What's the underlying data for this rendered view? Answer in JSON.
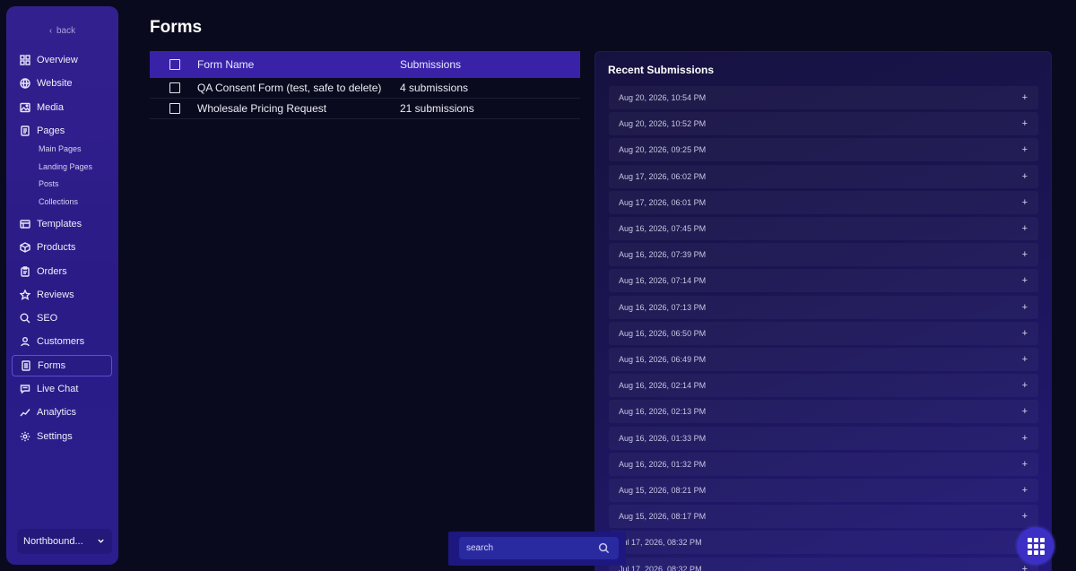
{
  "sidebar": {
    "back_label": "back",
    "items": [
      {
        "label": "Overview",
        "icon": "grid-icon"
      },
      {
        "label": "Website",
        "icon": "globe-icon"
      },
      {
        "label": "Media",
        "icon": "image-icon"
      },
      {
        "label": "Pages",
        "icon": "page-icon"
      },
      {
        "label": "Templates",
        "icon": "templates-icon"
      },
      {
        "label": "Products",
        "icon": "box-icon"
      },
      {
        "label": "Orders",
        "icon": "clipboard-icon"
      },
      {
        "label": "Reviews",
        "icon": "star-icon"
      },
      {
        "label": "SEO",
        "icon": "search-icon"
      },
      {
        "label": "Customers",
        "icon": "user-icon"
      },
      {
        "label": "Forms",
        "icon": "form-icon",
        "active": true
      },
      {
        "label": "Live Chat",
        "icon": "chat-icon"
      },
      {
        "label": "Analytics",
        "icon": "chart-icon"
      },
      {
        "label": "Settings",
        "icon": "gear-icon"
      }
    ],
    "page_subitems": [
      "Main Pages",
      "Landing Pages",
      "Posts",
      "Collections"
    ],
    "workspace": "Northbound..."
  },
  "main": {
    "title": "Forms",
    "table": {
      "headers": {
        "name": "Form Name",
        "submissions": "Submissions"
      },
      "rows": [
        {
          "name": "QA Consent Form (test, safe to delete)",
          "submissions": "4 submissions"
        },
        {
          "name": "Wholesale Pricing Request",
          "submissions": "21 submissions"
        }
      ]
    }
  },
  "recent": {
    "title": "Recent Submissions",
    "items": [
      "Aug 20, 2026, 10:54 PM",
      "Aug 20, 2026, 10:52 PM",
      "Aug 20, 2026, 09:25 PM",
      "Aug 17, 2026, 06:02 PM",
      "Aug 17, 2026, 06:01 PM",
      "Aug 16, 2026, 07:45 PM",
      "Aug 16, 2026, 07:39 PM",
      "Aug 16, 2026, 07:14 PM",
      "Aug 16, 2026, 07:13 PM",
      "Aug 16, 2026, 06:50 PM",
      "Aug 16, 2026, 06:49 PM",
      "Aug 16, 2026, 02:14 PM",
      "Aug 16, 2026, 02:13 PM",
      "Aug 16, 2026, 01:33 PM",
      "Aug 16, 2026, 01:32 PM",
      "Aug 15, 2026, 08:21 PM",
      "Aug 15, 2026, 08:17 PM",
      "Jul 17, 2026, 08:32 PM",
      "Jul 17, 2026, 08:32 PM"
    ],
    "expand_symbol": "+"
  },
  "search": {
    "placeholder": "search"
  }
}
